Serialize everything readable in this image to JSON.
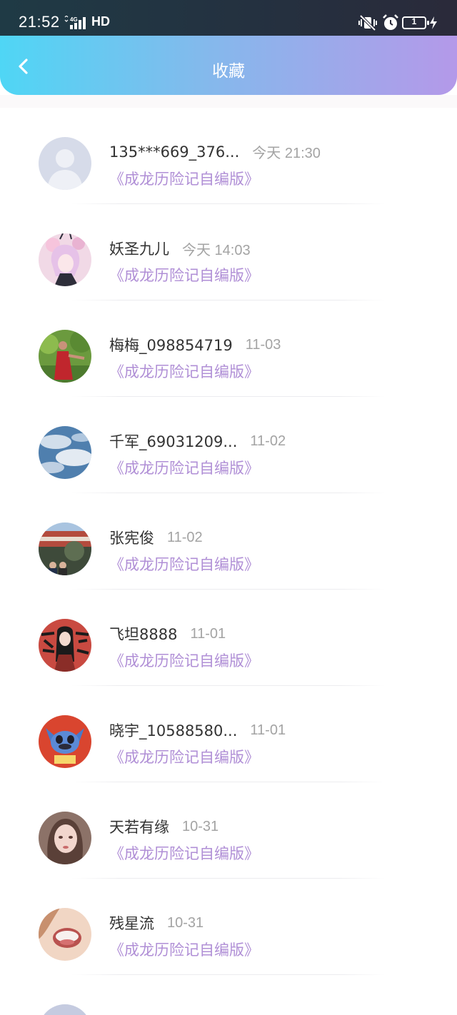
{
  "status_bar": {
    "time": "21:52",
    "network": "4G",
    "hd": "HD",
    "battery": "1",
    "icons": [
      "signal-icon",
      "mute-vibrate-icon",
      "alarm-icon",
      "battery-icon",
      "charging-icon"
    ]
  },
  "header": {
    "title": "收藏",
    "back_icon": "chevron-left-icon",
    "gradient": [
      "#4fd6f5",
      "#b499e9"
    ]
  },
  "colors": {
    "name": "#333333",
    "time": "#a3a3a3",
    "work_title": "#b08fd6"
  },
  "favorites": [
    {
      "name": "135***669_376...",
      "time": "今天 21:30",
      "title": "《成龙历险记自编版》",
      "avatar": "default-user-avatar"
    },
    {
      "name": "妖圣九儿",
      "time": "今天 14:03",
      "title": "《成龙历险记自编版》",
      "avatar": "anime-girl-avatar"
    },
    {
      "name": "梅梅_098854719",
      "time": "11-03",
      "title": "《成龙历险记自编版》",
      "avatar": "woman-outdoor-photo-avatar"
    },
    {
      "name": "千军_69031209...",
      "time": "11-02",
      "title": "《成龙历险记自编版》",
      "avatar": "earth-clouds-avatar"
    },
    {
      "name": "张宪俊",
      "time": "11-02",
      "title": "《成龙历险记自编版》",
      "avatar": "palace-photo-avatar"
    },
    {
      "name": "飞坦8888",
      "time": "11-01",
      "title": "《成龙历险记自编版》",
      "avatar": "calligraphy-girl-avatar"
    },
    {
      "name": "晓宇_10588580...",
      "time": "11-01",
      "title": "《成龙历险记自编版》",
      "avatar": "stitch-cartoon-avatar"
    },
    {
      "name": "天若有缘",
      "time": "10-31",
      "title": "《成龙历险记自编版》",
      "avatar": "painted-girl-avatar"
    },
    {
      "name": "残星流",
      "time": "10-31",
      "title": "《成龙历险记自编版》",
      "avatar": "closeup-face-avatar"
    }
  ]
}
